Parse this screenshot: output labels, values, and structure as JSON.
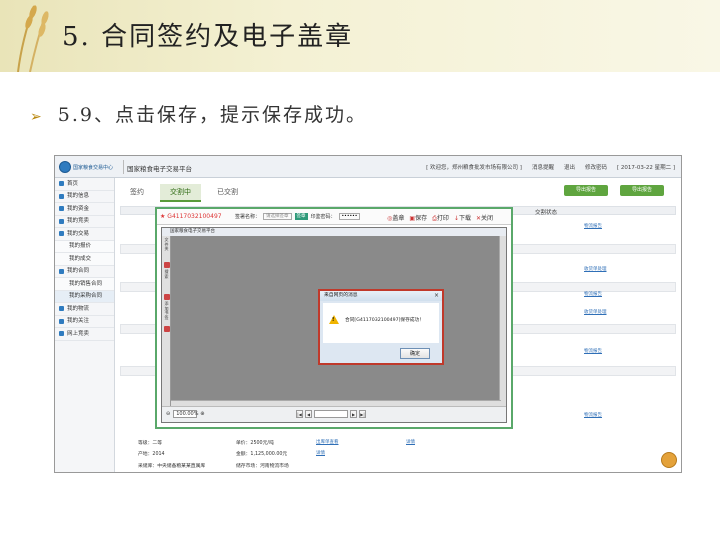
{
  "slide": {
    "title": "5. 合同签约及电子盖章",
    "subtitle": "5.9、点击保存，提示保存成功。",
    "bullet": "➢"
  },
  "app": {
    "logo_text": "国家粮食交易中心",
    "platform_title": "国家粮食电子交易平台",
    "topbar_links": [
      "[ 欢迎您，郑州粮食批发市场有限公司 ]",
      "消息提醒",
      "退出",
      "修改密码",
      "[ 2017-03-22 星期二 ]"
    ],
    "sidebar": [
      {
        "label": "首页",
        "sub": false
      },
      {
        "label": "我的信息",
        "sub": false
      },
      {
        "label": "我的资金",
        "sub": false
      },
      {
        "label": "我的竞卖",
        "sub": false
      },
      {
        "label": "我的交易",
        "sub": false
      },
      {
        "label": "我的报价",
        "sub": true
      },
      {
        "label": "我的成交",
        "sub": true
      },
      {
        "label": "我的合同",
        "sub": false
      },
      {
        "label": "我的销售合同",
        "sub": true
      },
      {
        "label": "我的采购合同",
        "sub": true
      },
      {
        "label": "我的物流",
        "sub": false
      },
      {
        "label": "我的关注",
        "sub": false
      },
      {
        "label": "网上竞卖",
        "sub": false
      }
    ],
    "tabs": [
      "签约",
      "交割中",
      "已交割"
    ],
    "right_buttons": [
      "导出报告",
      "导出报告"
    ],
    "col_header": "交割状态",
    "row_links": [
      "物流报告",
      "物流报告",
      "物流报告",
      "物流报告",
      "收货单处理",
      "收货单处理"
    ],
    "bottom_rows": [
      {
        "a": "等级：二等",
        "b": "单价：2500元/吨",
        "c": "出库单查看",
        "d": "详情"
      },
      {
        "a": "产地：2014",
        "b": "金额：1,125,000.00元",
        "c": "详情",
        "d": ""
      },
      {
        "a": "采储库：中央储备粮某某直属库",
        "b": "储存市场：河南物流市场",
        "c": "",
        "d": ""
      }
    ]
  },
  "dialog": {
    "contract_no": "G411703210049​7",
    "field1_label": "签署名称：",
    "field1_value": "请选择签章",
    "sign_button": "签章",
    "field2_label": "印鉴密码：",
    "field2_value": "••••••",
    "actions": [
      "盖章",
      "保存",
      "打印",
      "下载",
      "关闭"
    ],
    "viewer_title": "国家粮食电子交易平台",
    "side_labels": [
      "文件夹",
      "搜索",
      "添加书签"
    ],
    "zoom": "100.00%"
  },
  "message": {
    "title": "来自网页的消息",
    "close": "×",
    "text": "合同[G411703210049​7]保存成功！",
    "ok": "确定"
  }
}
